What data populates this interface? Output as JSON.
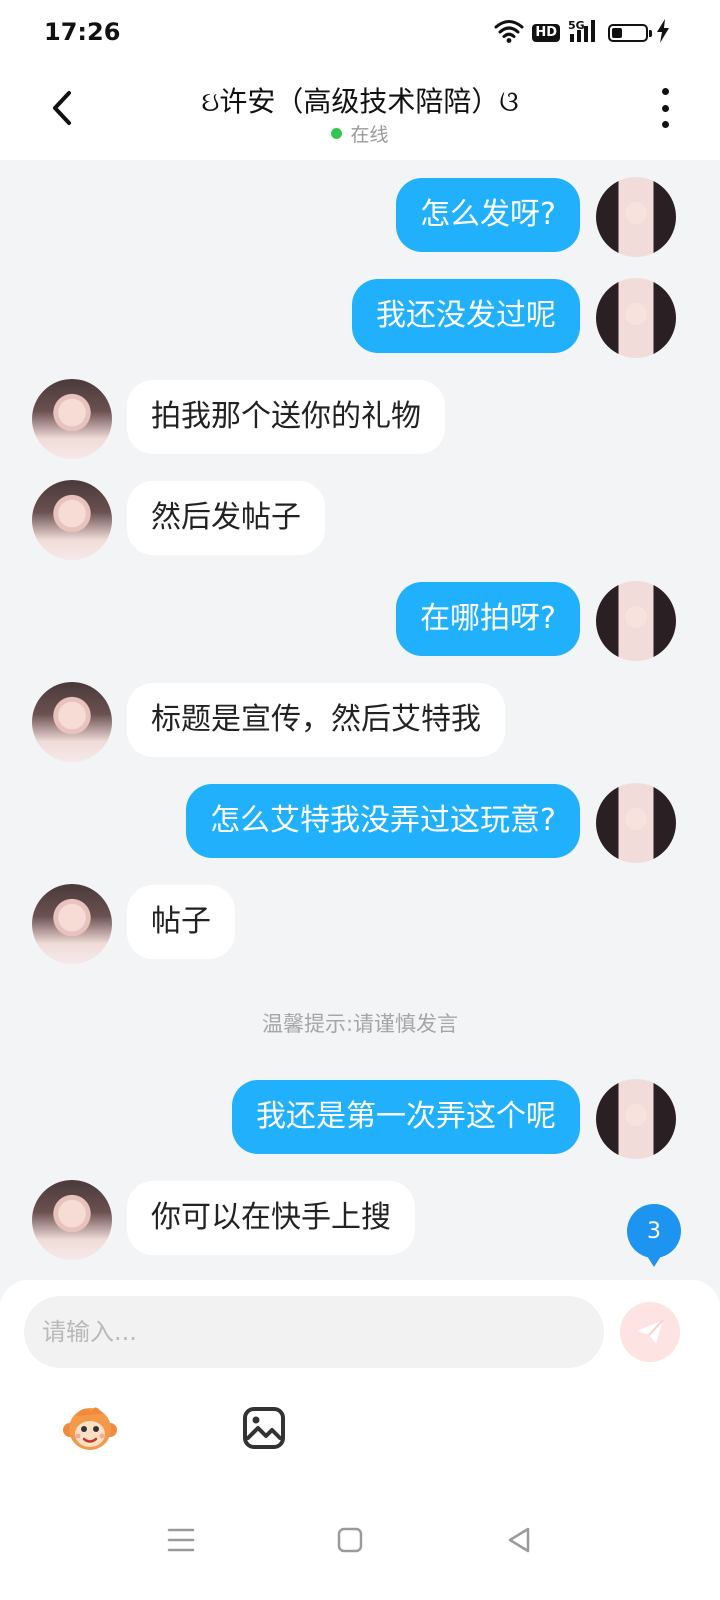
{
  "status_bar": {
    "time": "17:26",
    "hd_label": "HD",
    "network_label": "5G",
    "battery_level": 0.3,
    "icons": [
      "wifi-icon",
      "hd-icon",
      "signal-5g-icon",
      "battery-icon",
      "charging-icon"
    ]
  },
  "header": {
    "title": "ઇ许安（高级技术陪陪）ଓ",
    "status_text": "在线",
    "status_color": "#32c754",
    "back_icon": "chevron-left-icon",
    "more_icon": "more-vertical-icon"
  },
  "messages": [
    {
      "side": "right",
      "text": "怎么发呀?"
    },
    {
      "side": "right",
      "text": "我还没发过呢"
    },
    {
      "side": "left",
      "text": "拍我那个送你的礼物"
    },
    {
      "side": "left",
      "text": "然后发帖子"
    },
    {
      "side": "right",
      "text": "在哪拍呀?"
    },
    {
      "side": "left",
      "text": "标题是宣传，然后艾特我"
    },
    {
      "side": "right",
      "text": "怎么艾特我没弄过这玩意?"
    },
    {
      "side": "left",
      "text": "帖子"
    },
    {
      "side": "right",
      "text": "我还是第一次弄这个呢"
    },
    {
      "side": "left",
      "text": "你可以在快手上搜"
    }
  ],
  "tip": "温馨提示:请谨慎发言",
  "unread_count": "3",
  "input": {
    "placeholder": "请输入...",
    "value": ""
  },
  "toolbar": {
    "items": [
      "monkey-emoji-icon",
      "image-icon"
    ],
    "send_icon": "send-icon"
  },
  "colors": {
    "outgoing_bubble": "#21b0fb",
    "incoming_bubble": "#ffffff",
    "chat_background": "#f3f4f6",
    "badge": "#1d94f0",
    "send_button": "#fde3e1"
  },
  "nav": [
    "menu-icon",
    "home-square-icon",
    "back-triangle-icon"
  ]
}
